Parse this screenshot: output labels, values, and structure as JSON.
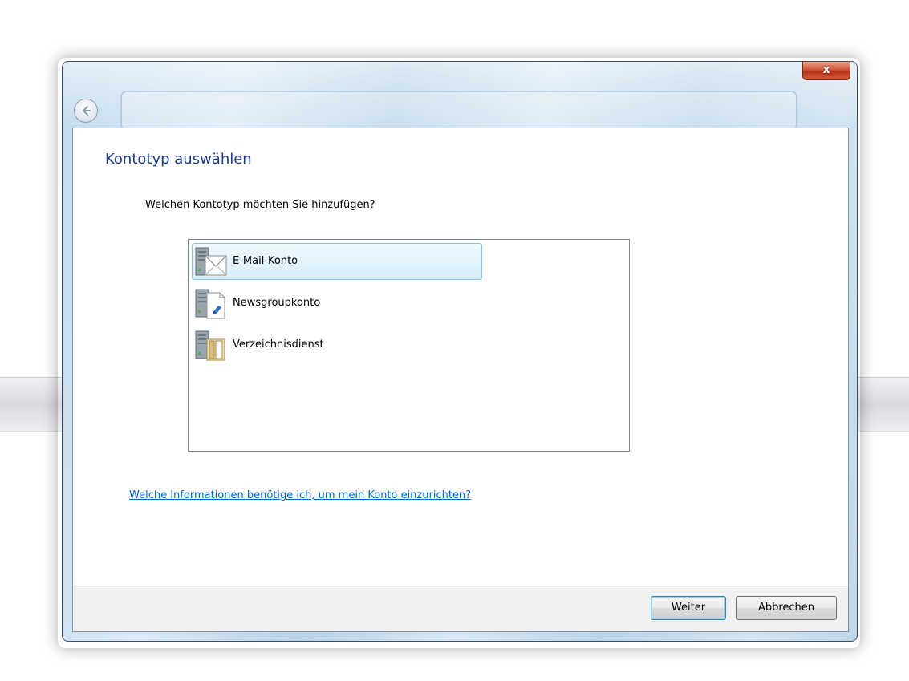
{
  "window": {
    "close_label": "x"
  },
  "page": {
    "title": "Kontotyp auswählen",
    "question": "Welchen Kontotyp möchten Sie hinzufügen?",
    "help_link": "Welche Informationen benötige ich, um mein Konto einzurichten?"
  },
  "account_types": {
    "items": [
      {
        "label": "E-Mail-Konto",
        "icon": "email-server-icon",
        "selected": true
      },
      {
        "label": "Newsgroupkonto",
        "icon": "newsgroup-server-icon",
        "selected": false
      },
      {
        "label": "Verzeichnisdienst",
        "icon": "directory-server-icon",
        "selected": false
      }
    ]
  },
  "footer": {
    "next_label": "Weiter",
    "cancel_label": "Abbrechen"
  },
  "colors": {
    "title": "#1e3b87",
    "link": "#0066cc",
    "selection_border": "#84c6ea",
    "close_button": "#c4432a"
  }
}
